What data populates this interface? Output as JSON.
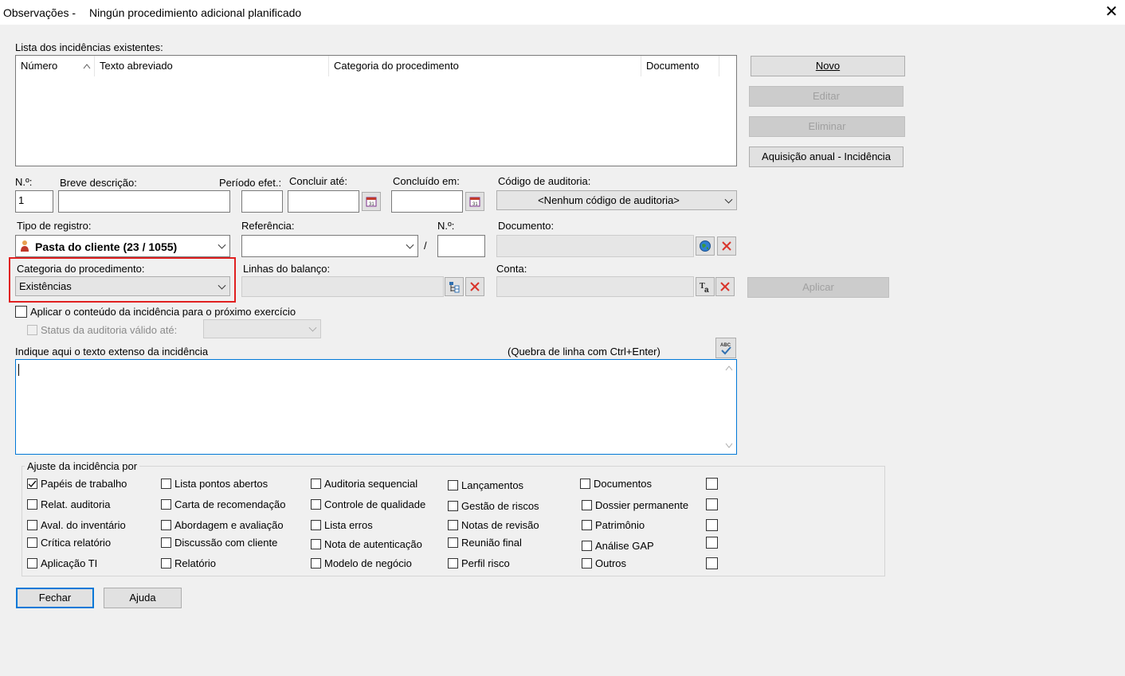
{
  "window": {
    "title_prefix": "Observações -",
    "title_main": "Ningún procedimiento adicional planificado",
    "close_glyph": "✕"
  },
  "list": {
    "label": "Lista dos incidências existentes:",
    "columns": [
      "Número",
      "Texto abreviado",
      "Categoria do procedimento",
      "Documento"
    ],
    "sort_glyph": "^"
  },
  "buttons": {
    "novo": "Novo",
    "editar": "Editar",
    "eliminar": "Eliminar",
    "aquisicao": "Aquisição anual - Incidência",
    "aplicar": "Aplicar",
    "fechar": "Fechar",
    "ajuda": "Ajuda"
  },
  "fields": {
    "numero_label": "N.º:",
    "numero_value": "1",
    "breve_label": "Breve descrição:",
    "breve_value": "",
    "periodo_label": "Período efet.:",
    "concluir_label": "Concluir até:",
    "concluido_label": "Concluído em:",
    "codigo_label": "Código de auditoria:",
    "codigo_value": "<Nenhum código de auditoria>",
    "tipo_label": "Tipo de registro:",
    "tipo_value": "Pasta do cliente (23 / 1055)",
    "referencia_label": "Referência:",
    "slash": "/",
    "ref_numero_label": "N.º:",
    "documento_label": "Documento:",
    "categoria_label": "Categoria do procedimento:",
    "categoria_value": "Existências",
    "linhas_label": "Linhas do balanço:",
    "conta_label": "Conta:",
    "aplicar_conteudo": "Aplicar o conteúdo da incidência para o próximo exercício",
    "status_label": "Status da auditoria válido até:",
    "texto_label": "Indique aqui o texto extenso da incidência",
    "quebra_label": "(Quebra de linha com Ctrl+Enter)"
  },
  "group": {
    "title": "Ajuste da incidência por",
    "items": [
      {
        "label": "Papéis de trabalho",
        "checked": true
      },
      {
        "label": "Lista pontos abertos",
        "checked": false
      },
      {
        "label": "Auditoria sequencial",
        "checked": false
      },
      {
        "label": "Lançamentos",
        "checked": false
      },
      {
        "label": "Documentos",
        "checked": false
      },
      {
        "label": "Relat. auditoria",
        "checked": false
      },
      {
        "label": "Carta de recomendação",
        "checked": false
      },
      {
        "label": "Controle de qualidade",
        "checked": false
      },
      {
        "label": "Gestão de riscos",
        "checked": false
      },
      {
        "label": "Dossier permanente",
        "checked": false
      },
      {
        "label": "Aval. do inventário",
        "checked": false
      },
      {
        "label": "Abordagem e avaliação",
        "checked": false
      },
      {
        "label": "Lista erros",
        "checked": false
      },
      {
        "label": "Notas de revisão",
        "checked": false
      },
      {
        "label": "Patrimônio",
        "checked": false
      },
      {
        "label": "Crítica relatório",
        "checked": false
      },
      {
        "label": "Discussão com cliente",
        "checked": false
      },
      {
        "label": "Nota de autenticação",
        "checked": false
      },
      {
        "label": "Reunião final",
        "checked": false
      },
      {
        "label": "Análise GAP",
        "checked": false
      },
      {
        "label": "Aplicação TI",
        "checked": false
      },
      {
        "label": "Relatório",
        "checked": false
      },
      {
        "label": "Modelo de negócio",
        "checked": false
      },
      {
        "label": "Perfil risco",
        "checked": false
      },
      {
        "label": "Outros",
        "checked": false
      }
    ]
  },
  "icons": {
    "calendar": "calendar-icon",
    "globe": "globe-icon",
    "delete": "delete-x-icon",
    "tree": "tree-icon",
    "text": "text-icon",
    "spell": "spellcheck-icon",
    "user": "user-icon"
  },
  "colors": {
    "highlight": "#e02020",
    "focus_border": "#0078d7",
    "delete_red": "#d9342b"
  }
}
